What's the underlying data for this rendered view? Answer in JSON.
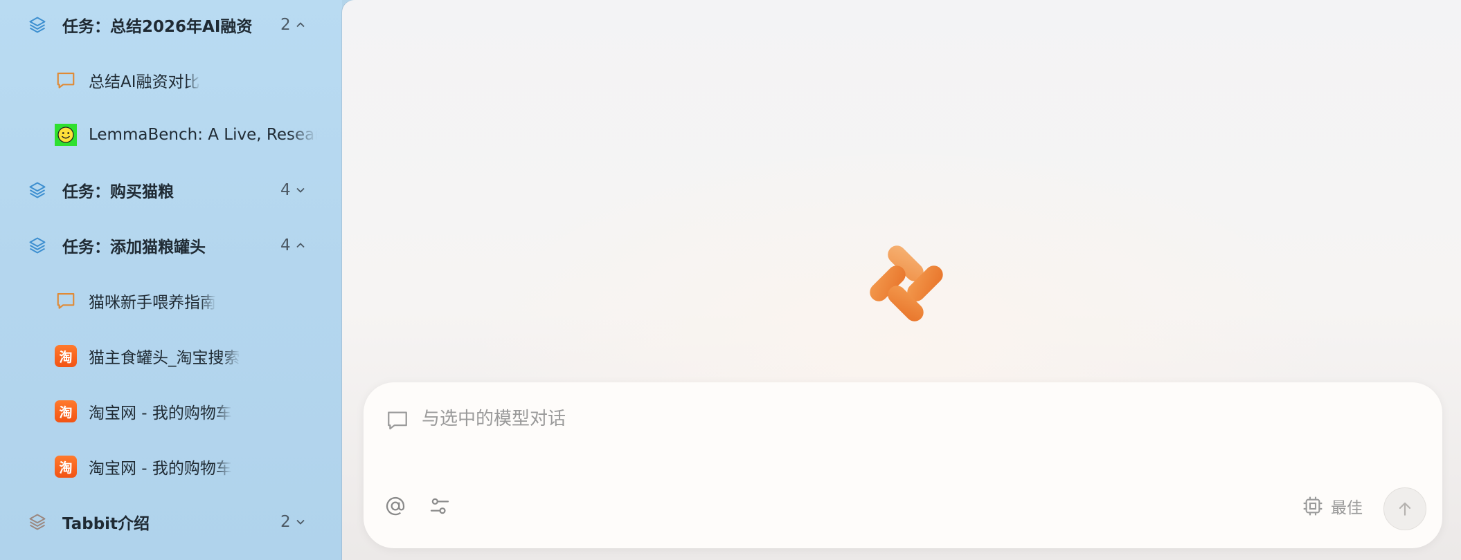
{
  "sidebar": {
    "rows": [
      {
        "kind": "group",
        "label": "任务：总结2026年AI融资",
        "count": "2",
        "expanded": true,
        "icon": "stack-icon"
      },
      {
        "kind": "item",
        "label": "总结AI融资对比",
        "icon": "chat-bubble-icon"
      },
      {
        "kind": "item",
        "label": "LemmaBench: A Live, Research",
        "icon": "smiley-favicon"
      },
      {
        "kind": "group",
        "label": "任务：购买猫粮",
        "count": "4",
        "expanded": false,
        "icon": "stack-icon"
      },
      {
        "kind": "group",
        "label": "任务：添加猫粮罐头",
        "count": "4",
        "expanded": true,
        "icon": "stack-icon"
      },
      {
        "kind": "item",
        "label": "猫咪新手喂养指南",
        "icon": "chat-bubble-icon"
      },
      {
        "kind": "item",
        "label": "猫主食罐头_淘宝搜索",
        "icon": "taobao-icon"
      },
      {
        "kind": "item",
        "label": "淘宝网 - 我的购物车",
        "icon": "taobao-icon"
      },
      {
        "kind": "item",
        "label": "淘宝网 - 我的购物车",
        "icon": "taobao-icon"
      },
      {
        "kind": "group",
        "label": "Tabbit介绍",
        "count": "2",
        "expanded": false,
        "icon": "stack-icon"
      }
    ],
    "taobao_glyph": "淘"
  },
  "composer": {
    "placeholder": "与选中的模型对话",
    "value": "",
    "model_label": "最佳"
  },
  "colors": {
    "sidebar_bg": "#b6d8ef",
    "stack_icon_blue": "#3d8fd0",
    "stack_icon_muted": "#9b8880",
    "chat_bubble_orange": "#e08a35",
    "taobao_orange": "#f25314",
    "logo_orange": "#f08a3a"
  }
}
